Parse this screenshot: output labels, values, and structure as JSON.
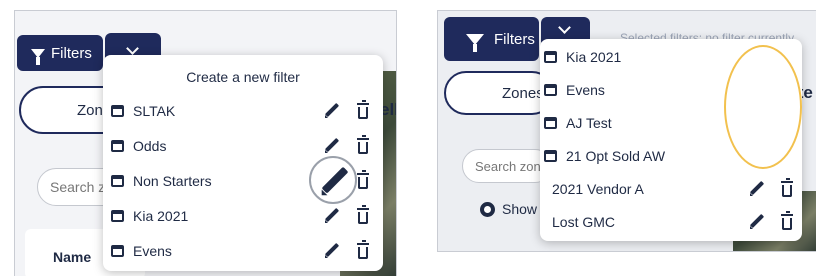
{
  "left": {
    "filters_label": "Filters",
    "zone_text": "Zone",
    "header_partial": "ell",
    "search_placeholder": "Search zo",
    "table_header": "Name",
    "dropdown": {
      "header": "Create a new filter",
      "items": [
        {
          "label": "SLTAK"
        },
        {
          "label": "Odds"
        },
        {
          "label": "Non Starters"
        },
        {
          "label": "Kia 2021"
        },
        {
          "label": "Evens"
        }
      ]
    }
  },
  "right": {
    "filters_label": "Filters",
    "zone_text": "Zones",
    "header_partial": "ite",
    "search_placeholder": "Search zon",
    "show_text": "Show",
    "top_hint_partial": "Selected filters: no filter currently",
    "dropdown": {
      "items": [
        {
          "label": "Kia 2021",
          "icon": "calendar-icon"
        },
        {
          "label": "Evens",
          "icon": "calendar-icon"
        },
        {
          "label": "AJ Test",
          "icon": "calendar-icon"
        },
        {
          "label": "21 Opt Sold AW",
          "icon": "calendar-icon"
        },
        {
          "label": "2021 Vendor A",
          "icon": ""
        },
        {
          "label": "Lost GMC",
          "icon": ""
        }
      ]
    }
  },
  "colors": {
    "navy": "#1f2a5c",
    "highlight": "#f2c14e"
  }
}
